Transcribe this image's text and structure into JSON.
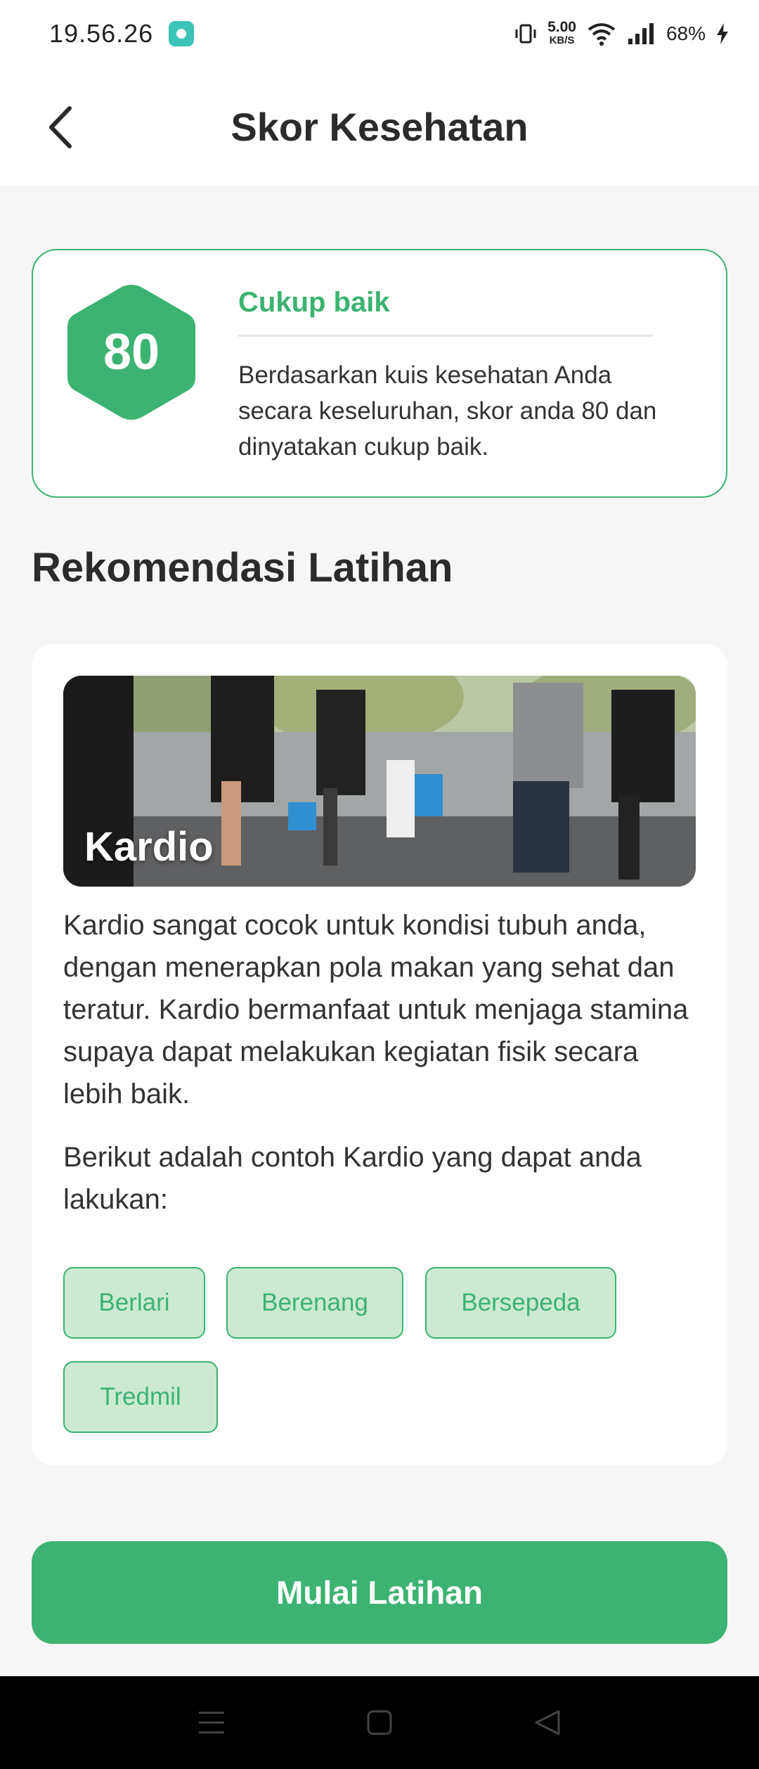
{
  "status_bar": {
    "time": "19.56.26",
    "net_speed_value": "5.00",
    "net_speed_unit": "KB/S",
    "battery": "68%"
  },
  "header": {
    "title": "Skor Kesehatan",
    "back_icon": "chevron-left-icon"
  },
  "score_card": {
    "score": "80",
    "label": "Cukup baik",
    "description": "Berdasarkan kuis kesehatan Anda secara keseluruhan, skor anda 80 dan dinyatakan cukup baik."
  },
  "recommendation": {
    "section_title": "Rekomendasi Latihan",
    "image_title": "Kardio",
    "description": "Kardio sangat cocok untuk kondisi tubuh anda, dengan menerapkan pola makan yang sehat dan teratur. Kardio bermanfaat untuk menjaga stamina supaya dapat melakukan kegiatan fisik secara lebih baik.",
    "examples_intro": "Berikut adalah contoh Kardio yang dapat anda lakukan:",
    "chips": [
      "Berlari",
      "Berenang",
      "Bersepeda",
      "Tredmil"
    ]
  },
  "cta": {
    "label": "Mulai Latihan"
  },
  "colors": {
    "accent": "#3cb371",
    "chip_bg": "#cbe9d3",
    "background": "#f6f6f6"
  }
}
